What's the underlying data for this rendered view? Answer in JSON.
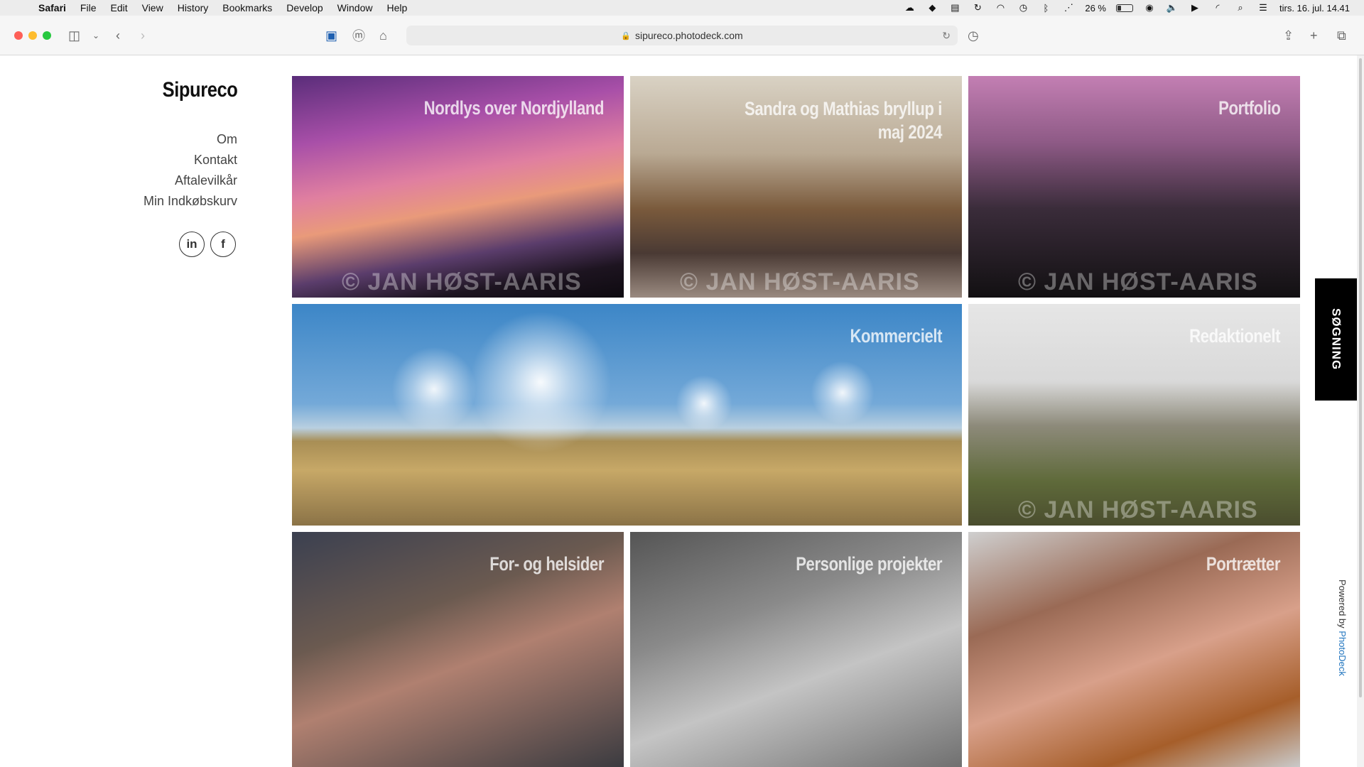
{
  "menubar": {
    "app": "Safari",
    "items": [
      "File",
      "Edit",
      "View",
      "History",
      "Bookmarks",
      "Develop",
      "Window",
      "Help"
    ],
    "battery_percent": "26 %",
    "battery_level": 0.26,
    "clock": "tirs. 16. jul.  14.41"
  },
  "browser": {
    "url": "sipureco.photodeck.com"
  },
  "site": {
    "brand": "Sipureco",
    "nav": [
      "Om",
      "Kontakt",
      "Aftalevilkår",
      "Min Indkøbskurv"
    ],
    "social": [
      {
        "icon": "linkedin-icon",
        "glyph": "in"
      },
      {
        "icon": "facebook-icon",
        "glyph": "f"
      }
    ],
    "search_tab": "SØGNING",
    "powered_by": "Powered by",
    "powered_brand": "PhotoDeck"
  },
  "tiles": [
    {
      "label": "Nordlys over Nordjylland",
      "watermark": "© JAN HØST-AARIS"
    },
    {
      "label": "Sandra og Mathias bryllup i maj 2024",
      "watermark": "© JAN HØST-AARIS"
    },
    {
      "label": "Portfolio",
      "watermark": "© JAN HØST-AARIS"
    },
    {
      "label": "Kommercielt",
      "watermark": ""
    },
    {
      "label": "Redaktionelt",
      "watermark": "© JAN HØST-AARIS"
    },
    {
      "label": "For- og helsider",
      "watermark": ""
    },
    {
      "label": "Personlige projekter",
      "watermark": ""
    },
    {
      "label": "Portrætter",
      "watermark": ""
    }
  ]
}
